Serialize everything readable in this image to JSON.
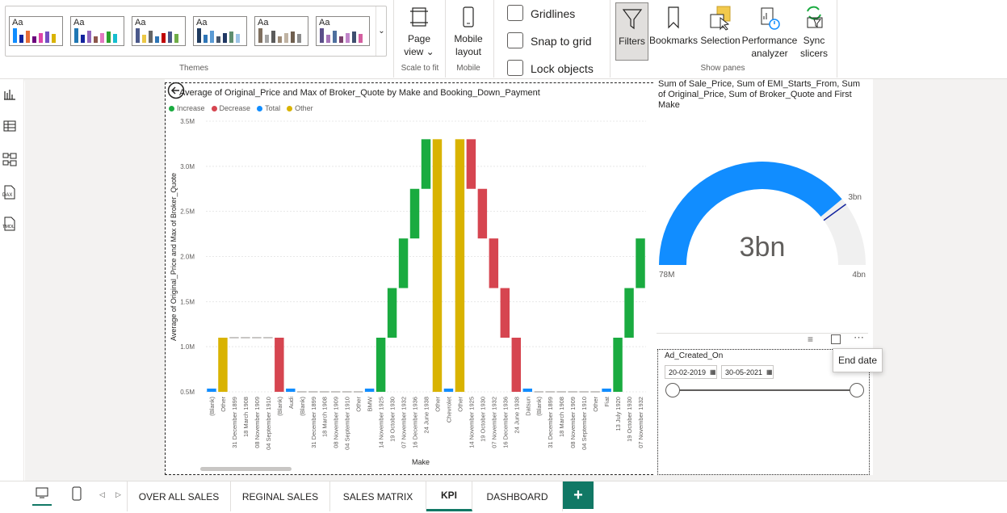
{
  "ribbon": {
    "themes_label": "Themes",
    "themes": [
      {
        "aa": "Aa",
        "colors": [
          "#118dff",
          "#12239e",
          "#e66c37",
          "#6b007b",
          "#e044a7",
          "#744ec2",
          "#d9b300"
        ]
      },
      {
        "aa": "Aa",
        "colors": [
          "#1f77b4",
          "#12239e",
          "#9467bd",
          "#8c564b",
          "#e377c2",
          "#2ca02c",
          "#17becf"
        ]
      },
      {
        "aa": "Aa",
        "colors": [
          "#4a588a",
          "#ecc846",
          "#666666",
          "#2e75b6",
          "#c00000",
          "#4a588a",
          "#70ad47"
        ]
      },
      {
        "aa": "Aa",
        "colors": [
          "#1e3a5f",
          "#2e75b6",
          "#5b9bd5",
          "#44546a",
          "#203864",
          "#5f8f6f",
          "#9dc3e6"
        ]
      },
      {
        "aa": "Aa",
        "colors": [
          "#7f6f5f",
          "#a5a5a5",
          "#5b5b5b",
          "#9e8b76",
          "#c0b3a3",
          "#6f5f4f",
          "#8c8c8c"
        ]
      },
      {
        "aa": "Aa",
        "colors": [
          "#5b4f8a",
          "#a673b8",
          "#4e6f9e",
          "#7a3f6b",
          "#c084c9",
          "#3f4f6f",
          "#d45fa0"
        ]
      }
    ],
    "page_view": {
      "line1": "Page",
      "line2": "view ⌄"
    },
    "scale_label": "Scale to fit",
    "mobile_layout": {
      "line1": "Mobile",
      "line2": "layout"
    },
    "mobile_label": "Mobile",
    "gridlines": "Gridlines",
    "snap_to_grid": "Snap to grid",
    "lock_objects": "Lock objects",
    "filters": "Filters",
    "bookmarks": "Bookmarks",
    "selection": "Selection",
    "performance": {
      "line1": "Performance",
      "line2": "analyzer"
    },
    "sync": {
      "line1": "Sync",
      "line2": "slicers"
    },
    "show_panes_label": "Show panes"
  },
  "waterfall": {
    "title": "Average of Original_Price and Max of Broker_Quote by Make and Booking_Down_Payment",
    "legend": [
      {
        "label": "Increase",
        "color": "#1aab40"
      },
      {
        "label": "Decrease",
        "color": "#d64550"
      },
      {
        "label": "Total",
        "color": "#118dff"
      },
      {
        "label": "Other",
        "color": "#d9b300"
      }
    ],
    "ylabel": "Average of Original_Price and Max of Broker_Quote",
    "xlabel": "Make",
    "yticks": [
      "3.5M",
      "3.0M",
      "2.5M",
      "2.0M",
      "1.5M",
      "1.0M",
      "0.5M"
    ]
  },
  "chart_data": {
    "type": "bar",
    "subtype": "waterfall",
    "ylim": [
      0.5,
      3.5
    ],
    "yunit": "M",
    "categories": [
      "(Blank)",
      "Other",
      "31 December 1899",
      "18 March 1908",
      "08 November 1909",
      "04 September 1910",
      "(Blank)",
      "Audi",
      "(Blank)",
      "31 December 1899",
      "18 March 1908",
      "08 November 1909",
      "04 September 1910",
      "Other",
      "BMW",
      "14 November 1925",
      "19 October 1930",
      "07 November 1932",
      "16 December 1936",
      "24 June 1938",
      "Other",
      "Chevrolet",
      "Other",
      "14 November 1925",
      "19 October 1930",
      "07 November 1932",
      "16 December 1936",
      "24 June 1938",
      "Datsun",
      "(Blank)",
      "31 December 1899",
      "18 March 1908",
      "08 November 1909",
      "04 September 1910",
      "Other",
      "Fiat",
      "13 July 1920",
      "19 October 1930",
      "07 November 1932"
    ],
    "kinds": [
      "total",
      "other",
      "flat",
      "flat",
      "flat",
      "flat",
      "decrease",
      "total",
      "flat",
      "flat",
      "flat",
      "flat",
      "flat",
      "flat",
      "total",
      "increase",
      "increase",
      "increase",
      "increase",
      "increase",
      "other",
      "total",
      "other",
      "decrease",
      "decrease",
      "decrease",
      "decrease",
      "decrease",
      "total",
      "flat",
      "flat",
      "flat",
      "flat",
      "flat",
      "flat",
      "total",
      "increase",
      "increase",
      "increase"
    ],
    "starts": [
      0.5,
      0.5,
      1.1,
      1.1,
      1.1,
      1.1,
      1.1,
      0.5,
      0.5,
      0.5,
      0.5,
      0.5,
      0.5,
      0.5,
      0.5,
      0.5,
      1.1,
      1.65,
      2.2,
      2.75,
      0.5,
      0.5,
      0.5,
      3.3,
      2.75,
      2.2,
      1.65,
      1.1,
      0.5,
      0.5,
      0.5,
      0.5,
      0.5,
      0.5,
      0.5,
      0.5,
      0.5,
      1.1,
      1.65
    ],
    "ends": [
      0.53,
      1.1,
      1.1,
      1.1,
      1.1,
      1.1,
      0.5,
      0.53,
      0.5,
      0.5,
      0.5,
      0.5,
      0.5,
      0.5,
      0.53,
      1.1,
      1.65,
      2.2,
      2.75,
      3.3,
      3.3,
      0.53,
      3.3,
      2.75,
      2.2,
      1.65,
      1.1,
      0.5,
      0.53,
      0.5,
      0.5,
      0.5,
      0.5,
      0.5,
      0.5,
      0.53,
      1.1,
      1.65,
      2.2
    ]
  },
  "gauge": {
    "title": "Sum of Sale_Price, Sum of EMI_Starts_From, Sum of Original_Price, Sum of Broker_Quote and First Make",
    "value_label": "3bn",
    "target_label": "3bn",
    "min_label": "78M",
    "max_label": "4bn",
    "fill_fraction": 0.78,
    "target_fraction": 0.8,
    "fill_color": "#118dff",
    "track_color": "#f0f0f0",
    "target_color": "#12239e"
  },
  "slicer": {
    "title": "Ad_Created_On",
    "start_date": "20-02-2019",
    "end_date": "30-05-2021",
    "tooltip": "End date"
  },
  "tabs": [
    "OVER ALL SALES",
    "REGINAL SALES",
    "SALES MATRIX",
    "KPI",
    "DASHBOARD"
  ],
  "active_tab": "KPI",
  "add_tab": "+"
}
